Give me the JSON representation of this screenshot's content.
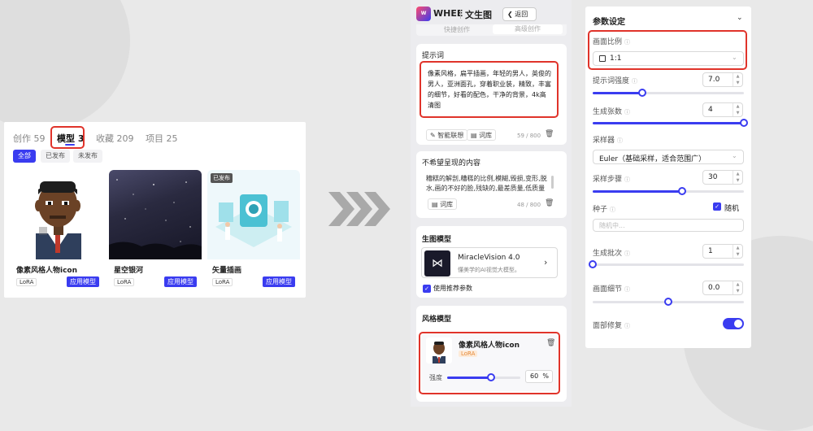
{
  "gallery": {
    "tabs": [
      {
        "label": "创作 59"
      },
      {
        "label": "模型 3"
      },
      {
        "label": "收藏 209"
      },
      {
        "label": "项目 25"
      }
    ],
    "filters": [
      "全部",
      "已发布",
      "未发布"
    ],
    "models": [
      {
        "name": "像素风格人物icon",
        "tag": "LoRA",
        "apply": "应用模型"
      },
      {
        "name": "星空银河",
        "tag": "LoRA",
        "apply": "应用模型"
      },
      {
        "name": "矢量插画",
        "tag": "LoRA",
        "apply": "应用模型",
        "badge": "已发布"
      }
    ]
  },
  "app": {
    "logo_text": "WHEE",
    "page_title": "文生图",
    "back_label": "返回",
    "mode_tabs": [
      "快捷创作",
      "高级创作"
    ]
  },
  "prompt": {
    "label": "提示词",
    "text": "像素风格，扁平插画，年轻的男人，英俊的男人，亚洲面孔，穿着职业装，精致，丰富的细节，好看的配色，干净的背景，4k高清图",
    "assist_label": "智能联想",
    "library_label": "词库",
    "count": "59 / 800"
  },
  "negative": {
    "label": "不希望呈现的内容",
    "text": "糟糕的解剖,糟糕的比例,模糊,毁损,变形,脱水,画的不好的脸,残缺的,最差质量,低质量",
    "library_label": "词库",
    "count": "48 / 800"
  },
  "base_model": {
    "section_label": "生图模型",
    "name": "MiracleVision 4.0",
    "desc": "懂美学的AI视觉大模型。",
    "recommend_label": "使用推荐参数"
  },
  "style_model": {
    "section_label": "风格模型",
    "name": "像素风格人物icon",
    "tag": "LoRA",
    "strength_label": "强度",
    "strength_value": "60",
    "strength_unit": "%",
    "strength_fraction": 0.6
  },
  "params": {
    "title": "参数设定",
    "ratio_label": "画面比例",
    "ratio_value": "1:1",
    "guidance_label": "提示词强度",
    "guidance_value": "7.0",
    "guidance_fraction": 0.33,
    "count_label": "生成张数",
    "count_value": "4",
    "count_fraction": 1.0,
    "sampler_label": "采样器",
    "sampler_value": "Euler（基础采样，适合范围广）",
    "steps_label": "采样步骤",
    "steps_value": "30",
    "steps_fraction": 0.59,
    "seed_label": "种子",
    "seed_random_label": "随机",
    "seed_placeholder": "随机中...",
    "batch_label": "生成批次",
    "batch_value": "1",
    "batch_fraction": 0.0,
    "detail_label": "画面细节",
    "detail_value": "0.0",
    "detail_fraction": 0.5,
    "face_fix_label": "面部修复",
    "face_fix_on": true
  },
  "colors": {
    "accent": "#3a3cf0",
    "highlight": "#e0332a"
  }
}
